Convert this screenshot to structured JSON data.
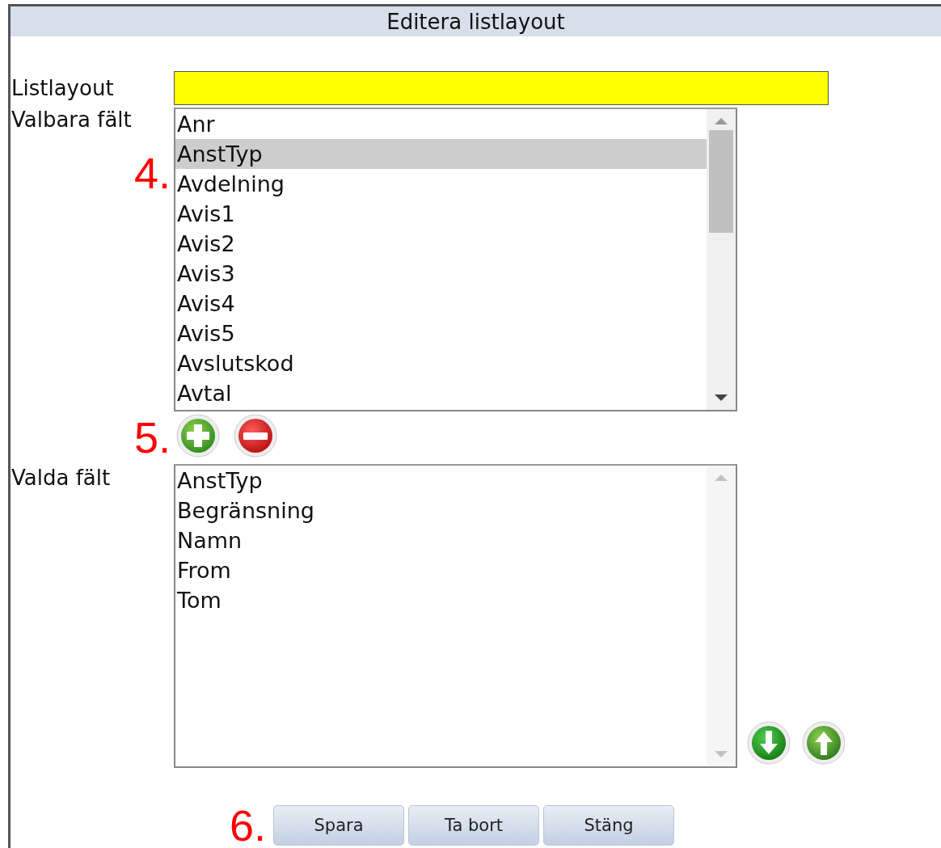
{
  "window": {
    "title": "Editera listlayout"
  },
  "listlayout_field": {
    "label": "Listlayout",
    "highlighted": true
  },
  "available_fields": {
    "label": "Valbara fält",
    "annotation": "4.",
    "scrollable": true,
    "items": [
      {
        "label": "Anr",
        "selected": false
      },
      {
        "label": "AnstTyp",
        "selected": true
      },
      {
        "label": "Avdelning",
        "selected": false
      },
      {
        "label": "Avis1",
        "selected": false
      },
      {
        "label": "Avis2",
        "selected": false
      },
      {
        "label": "Avis3",
        "selected": false
      },
      {
        "label": "Avis4",
        "selected": false
      },
      {
        "label": "Avis5",
        "selected": false
      },
      {
        "label": "Avslutskod",
        "selected": false
      },
      {
        "label": "Avtal",
        "selected": false
      }
    ]
  },
  "add_remove": {
    "annotation": "5."
  },
  "selected_fields": {
    "label": "Valda fält",
    "scrollable": false,
    "items": [
      {
        "label": "AnstTyp",
        "selected": false
      },
      {
        "label": "Begränsning",
        "selected": false
      },
      {
        "label": "Namn",
        "selected": false
      },
      {
        "label": "From",
        "selected": false
      },
      {
        "label": "Tom",
        "selected": false
      }
    ]
  },
  "footer": {
    "annotation": "6.",
    "buttons": [
      "Spara",
      "Ta bort",
      "Stäng"
    ]
  }
}
